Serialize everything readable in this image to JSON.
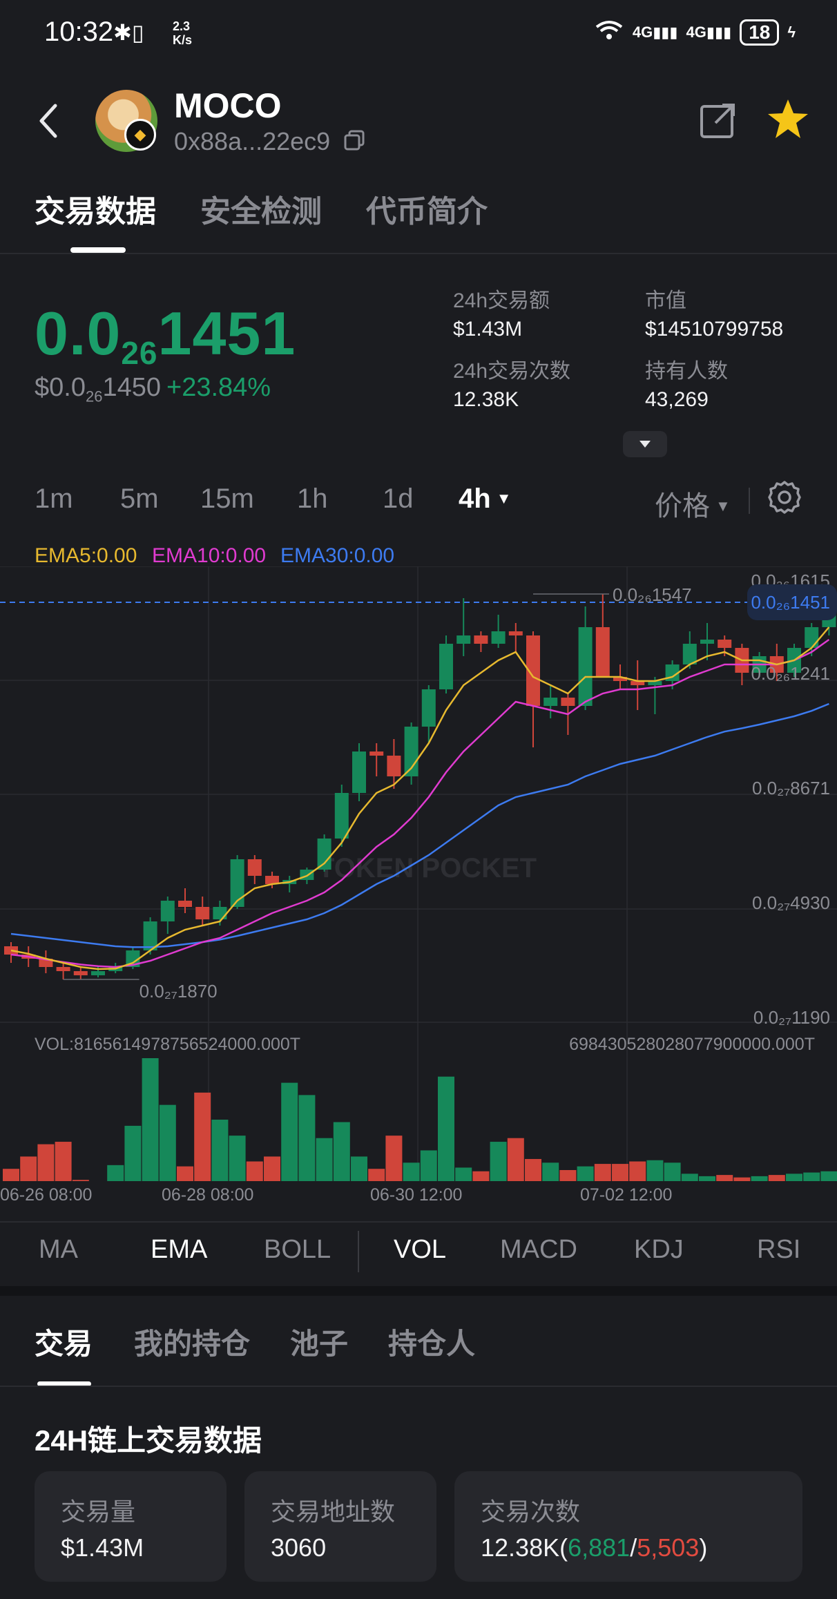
{
  "status_bar": {
    "time": "10:32",
    "net_speed_top": "2.3",
    "net_speed_bottom": "K/s",
    "battery": "18"
  },
  "header": {
    "token_name": "MOCO",
    "address": "0x88a...22ec9"
  },
  "tabs": [
    "交易数据",
    "安全检测",
    "代币简介"
  ],
  "price": {
    "main_prefix": "0.0",
    "main_sub": "26",
    "main_suffix": "1451",
    "usd_prefix": "$0.0",
    "usd_sub": "26",
    "usd_suffix": "1450",
    "change": "+23.84%"
  },
  "stats": {
    "vol_label": "24h交易额",
    "vol_value": "$1.43M",
    "mcap_label": "市值",
    "mcap_value": "$14510799758",
    "tx_label": "24h交易次数",
    "tx_value": "12.38K",
    "holders_label": "持有人数",
    "holders_value": "43,269"
  },
  "timeframes": [
    "1m",
    "5m",
    "15m",
    "1h",
    "1d",
    "4h"
  ],
  "price_selector": "价格",
  "ema_legend": {
    "ema5": "EMA5:0.00",
    "ema10": "EMA10:0.00",
    "ema30": "EMA30:0.00",
    "colors": {
      "ema5": "#e7b92f",
      "ema10": "#e03bd0",
      "ema30": "#3d7bf0"
    }
  },
  "chart_data": {
    "type": "candlestick",
    "y_axis_labels": [
      "0.0₂₆1615",
      "0.0₂₆1451",
      "0.0₂₆1241",
      "0.0₂₇8671",
      "0.0₂₇4930",
      "0.0₂₇1190"
    ],
    "current_price_label": "0.0₂₆1451",
    "high_label": "0.0₂₆1547",
    "low_label": "0.0₂₇1870",
    "x_axis_labels": [
      "06-26 08:00",
      "06-28 08:00",
      "06-30 12:00",
      "07-02 12:00"
    ],
    "vol_left": "VOL:8165614978756524000.000T",
    "vol_right": "698430528028077900000.000T",
    "candles": [
      {
        "o": 0.15,
        "h": 0.16,
        "l": 0.11,
        "c": 0.13
      },
      {
        "o": 0.13,
        "h": 0.15,
        "l": 0.1,
        "c": 0.12
      },
      {
        "o": 0.12,
        "h": 0.14,
        "l": 0.085,
        "c": 0.1
      },
      {
        "o": 0.1,
        "h": 0.11,
        "l": 0.07,
        "c": 0.09
      },
      {
        "o": 0.09,
        "h": 0.1,
        "l": 0.07,
        "c": 0.08
      },
      {
        "o": 0.08,
        "h": 0.1,
        "l": 0.075,
        "c": 0.09
      },
      {
        "o": 0.09,
        "h": 0.11,
        "l": 0.085,
        "c": 0.1
      },
      {
        "o": 0.1,
        "h": 0.15,
        "l": 0.095,
        "c": 0.14
      },
      {
        "o": 0.14,
        "h": 0.22,
        "l": 0.13,
        "c": 0.21
      },
      {
        "o": 0.21,
        "h": 0.27,
        "l": 0.18,
        "c": 0.26
      },
      {
        "o": 0.26,
        "h": 0.29,
        "l": 0.23,
        "c": 0.245
      },
      {
        "o": 0.245,
        "h": 0.27,
        "l": 0.2,
        "c": 0.215
      },
      {
        "o": 0.215,
        "h": 0.26,
        "l": 0.2,
        "c": 0.245
      },
      {
        "o": 0.245,
        "h": 0.37,
        "l": 0.24,
        "c": 0.36
      },
      {
        "o": 0.36,
        "h": 0.37,
        "l": 0.3,
        "c": 0.32
      },
      {
        "o": 0.32,
        "h": 0.33,
        "l": 0.29,
        "c": 0.3
      },
      {
        "o": 0.3,
        "h": 0.32,
        "l": 0.28,
        "c": 0.31
      },
      {
        "o": 0.31,
        "h": 0.34,
        "l": 0.3,
        "c": 0.335
      },
      {
        "o": 0.335,
        "h": 0.42,
        "l": 0.33,
        "c": 0.41
      },
      {
        "o": 0.41,
        "h": 0.54,
        "l": 0.39,
        "c": 0.52
      },
      {
        "o": 0.52,
        "h": 0.64,
        "l": 0.5,
        "c": 0.62
      },
      {
        "o": 0.62,
        "h": 0.64,
        "l": 0.56,
        "c": 0.61
      },
      {
        "o": 0.61,
        "h": 0.65,
        "l": 0.53,
        "c": 0.56
      },
      {
        "o": 0.56,
        "h": 0.69,
        "l": 0.54,
        "c": 0.68
      },
      {
        "o": 0.68,
        "h": 0.78,
        "l": 0.64,
        "c": 0.77
      },
      {
        "o": 0.77,
        "h": 0.9,
        "l": 0.76,
        "c": 0.88
      },
      {
        "o": 0.88,
        "h": 0.99,
        "l": 0.85,
        "c": 0.9
      },
      {
        "o": 0.9,
        "h": 0.91,
        "l": 0.86,
        "c": 0.88
      },
      {
        "o": 0.88,
        "h": 0.95,
        "l": 0.87,
        "c": 0.91
      },
      {
        "o": 0.91,
        "h": 0.93,
        "l": 0.86,
        "c": 0.9
      },
      {
        "o": 0.9,
        "h": 0.91,
        "l": 0.63,
        "c": 0.73
      },
      {
        "o": 0.73,
        "h": 0.78,
        "l": 0.7,
        "c": 0.75
      },
      {
        "o": 0.75,
        "h": 0.76,
        "l": 0.66,
        "c": 0.73
      },
      {
        "o": 0.73,
        "h": 0.97,
        "l": 0.72,
        "c": 0.92
      },
      {
        "o": 0.92,
        "h": 1.0,
        "l": 0.8,
        "c": 0.8
      },
      {
        "o": 0.8,
        "h": 0.83,
        "l": 0.77,
        "c": 0.79
      },
      {
        "o": 0.79,
        "h": 0.84,
        "l": 0.72,
        "c": 0.78
      },
      {
        "o": 0.78,
        "h": 0.8,
        "l": 0.71,
        "c": 0.79
      },
      {
        "o": 0.79,
        "h": 0.84,
        "l": 0.77,
        "c": 0.83
      },
      {
        "o": 0.83,
        "h": 0.91,
        "l": 0.82,
        "c": 0.88
      },
      {
        "o": 0.88,
        "h": 0.93,
        "l": 0.84,
        "c": 0.89
      },
      {
        "o": 0.89,
        "h": 0.9,
        "l": 0.85,
        "c": 0.87
      },
      {
        "o": 0.87,
        "h": 0.88,
        "l": 0.78,
        "c": 0.81
      },
      {
        "o": 0.81,
        "h": 0.86,
        "l": 0.8,
        "c": 0.85
      },
      {
        "o": 0.85,
        "h": 0.88,
        "l": 0.79,
        "c": 0.81
      },
      {
        "o": 0.81,
        "h": 0.88,
        "l": 0.8,
        "c": 0.87
      },
      {
        "o": 0.87,
        "h": 0.93,
        "l": 0.85,
        "c": 0.92
      },
      {
        "o": 0.92,
        "h": 0.99,
        "l": 0.9,
        "c": 0.98
      }
    ],
    "volumes": [
      0.1,
      0.2,
      0.3,
      0.32,
      0.01,
      0.0,
      0.13,
      0.45,
      1.0,
      0.62,
      0.12,
      0.72,
      0.5,
      0.37,
      0.16,
      0.2,
      0.8,
      0.7,
      0.35,
      0.48,
      0.2,
      0.1,
      0.37,
      0.15,
      0.25,
      0.85,
      0.11,
      0.08,
      0.32,
      0.35,
      0.18,
      0.15,
      0.09,
      0.12,
      0.14,
      0.14,
      0.16,
      0.17,
      0.15,
      0.06,
      0.04,
      0.05,
      0.03,
      0.04,
      0.05,
      0.06,
      0.07,
      0.08
    ],
    "ema5": [
      0.14,
      0.132,
      0.12,
      0.11,
      0.1,
      0.095,
      0.096,
      0.11,
      0.14,
      0.17,
      0.19,
      0.2,
      0.21,
      0.26,
      0.29,
      0.3,
      0.305,
      0.32,
      0.35,
      0.4,
      0.47,
      0.52,
      0.54,
      0.58,
      0.64,
      0.72,
      0.78,
      0.81,
      0.84,
      0.86,
      0.8,
      0.78,
      0.76,
      0.8,
      0.8,
      0.8,
      0.79,
      0.79,
      0.8,
      0.83,
      0.85,
      0.86,
      0.84,
      0.84,
      0.83,
      0.84,
      0.87,
      0.92
    ],
    "ema10": [
      0.13,
      0.125,
      0.118,
      0.112,
      0.106,
      0.102,
      0.1,
      0.105,
      0.115,
      0.13,
      0.145,
      0.16,
      0.17,
      0.19,
      0.21,
      0.23,
      0.245,
      0.26,
      0.28,
      0.31,
      0.35,
      0.39,
      0.42,
      0.46,
      0.51,
      0.57,
      0.62,
      0.66,
      0.7,
      0.74,
      0.73,
      0.72,
      0.71,
      0.74,
      0.76,
      0.77,
      0.77,
      0.775,
      0.78,
      0.8,
      0.815,
      0.83,
      0.83,
      0.83,
      0.83,
      0.84,
      0.86,
      0.89
    ],
    "ema30": [
      0.18,
      0.175,
      0.17,
      0.165,
      0.16,
      0.155,
      0.15,
      0.148,
      0.148,
      0.15,
      0.155,
      0.16,
      0.166,
      0.175,
      0.185,
      0.195,
      0.205,
      0.215,
      0.23,
      0.25,
      0.275,
      0.3,
      0.32,
      0.345,
      0.37,
      0.4,
      0.43,
      0.46,
      0.49,
      0.51,
      0.52,
      0.53,
      0.54,
      0.56,
      0.575,
      0.59,
      0.6,
      0.61,
      0.625,
      0.64,
      0.655,
      0.668,
      0.676,
      0.685,
      0.695,
      0.705,
      0.718,
      0.735
    ]
  },
  "indicators": [
    "MA",
    "EMA",
    "BOLL",
    "VOL",
    "MACD",
    "KDJ",
    "RSI"
  ],
  "bottom_tabs": [
    "交易",
    "我的持仓",
    "池子",
    "持仓人"
  ],
  "section_title": "24H链上交易数据",
  "cards": {
    "volume_label": "交易量",
    "volume_value": "$1.43M",
    "addr_label": "交易地址数",
    "addr_value": "3060",
    "count_label": "交易次数",
    "count_total": "12.38K",
    "count_buy": "6,881",
    "count_sell": "5,503"
  }
}
